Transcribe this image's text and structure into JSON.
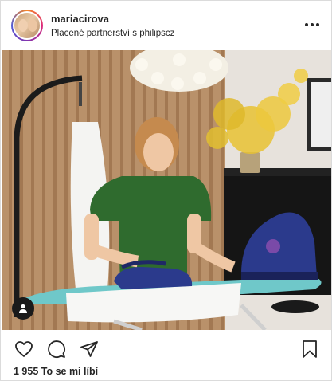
{
  "post": {
    "username": "mariacirova",
    "sponsor_prefix": "Placené partnerství s",
    "sponsor_brand": "philipscz",
    "likes_text": "1 955 To se mi líbí"
  },
  "icons": {
    "more": "more-horizontal-icon",
    "like": "heart-icon",
    "comment": "comment-bubble-icon",
    "share": "paper-plane-icon",
    "save": "bookmark-icon",
    "tag": "user-tag-icon"
  },
  "colors": {
    "text": "#262626",
    "border": "#dbdbdb",
    "shirt": "#2f6b2e",
    "steamer": "#2b3a8c",
    "board": "#6fc8c9"
  }
}
